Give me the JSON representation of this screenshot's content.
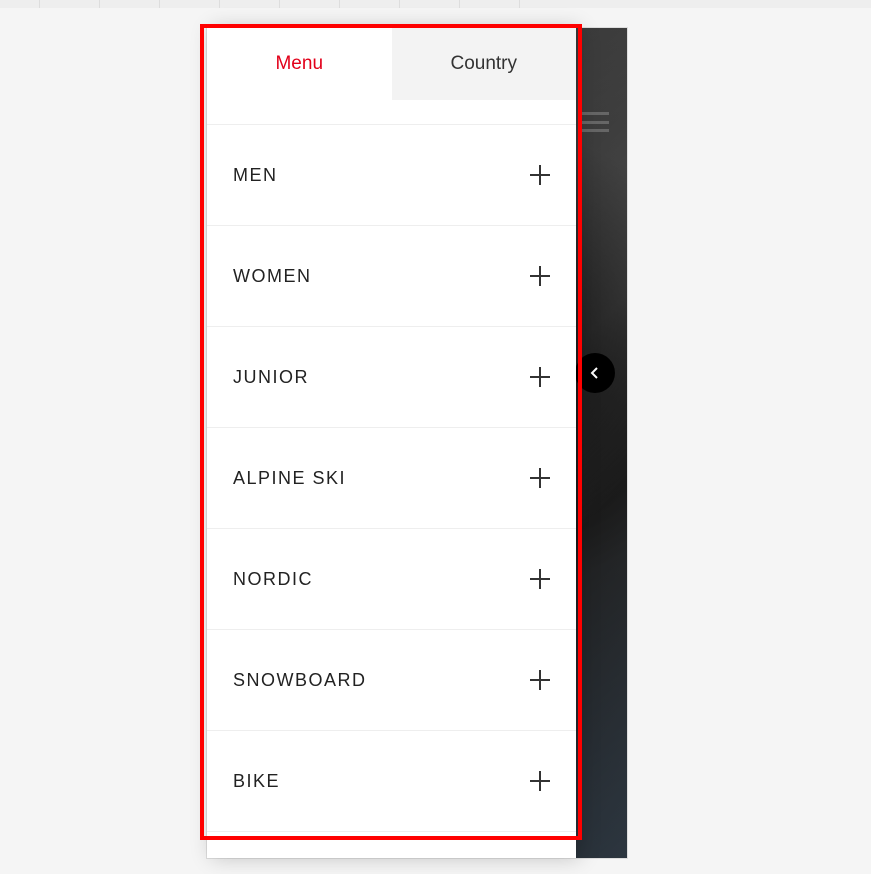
{
  "tabs": {
    "active": "Menu",
    "inactive": "Country"
  },
  "categories": [
    {
      "label": "MEN"
    },
    {
      "label": "WOMEN"
    },
    {
      "label": "JUNIOR"
    },
    {
      "label": "ALPINE SKI"
    },
    {
      "label": "NORDIC"
    },
    {
      "label": "SNOWBOARD"
    },
    {
      "label": "BIKE"
    }
  ]
}
